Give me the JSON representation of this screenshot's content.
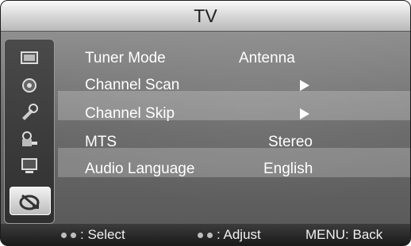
{
  "header": {
    "title": "TV"
  },
  "sidebar": {
    "icons": [
      {
        "name": "picture-icon"
      },
      {
        "name": "sound-icon"
      },
      {
        "name": "setup-icon"
      },
      {
        "name": "lock-icon"
      },
      {
        "name": "input-icon"
      },
      {
        "name": "tv-channel-icon",
        "active": true
      }
    ]
  },
  "menu": {
    "items": [
      {
        "label": "Tuner Mode",
        "value": "Antenna"
      },
      {
        "label": "Channel  Scan",
        "value": ""
      },
      {
        "label": "Channel  Skip",
        "value": ""
      },
      {
        "label": "MTS",
        "value": "Stereo"
      },
      {
        "label": "Audio  Language",
        "value": "English"
      }
    ],
    "submenu_arrow_items": [
      1,
      2
    ],
    "highlighted_items": [
      1,
      3
    ]
  },
  "footer": {
    "select": ": Select",
    "adjust": ": Adjust",
    "back": "MENU:  Back"
  }
}
